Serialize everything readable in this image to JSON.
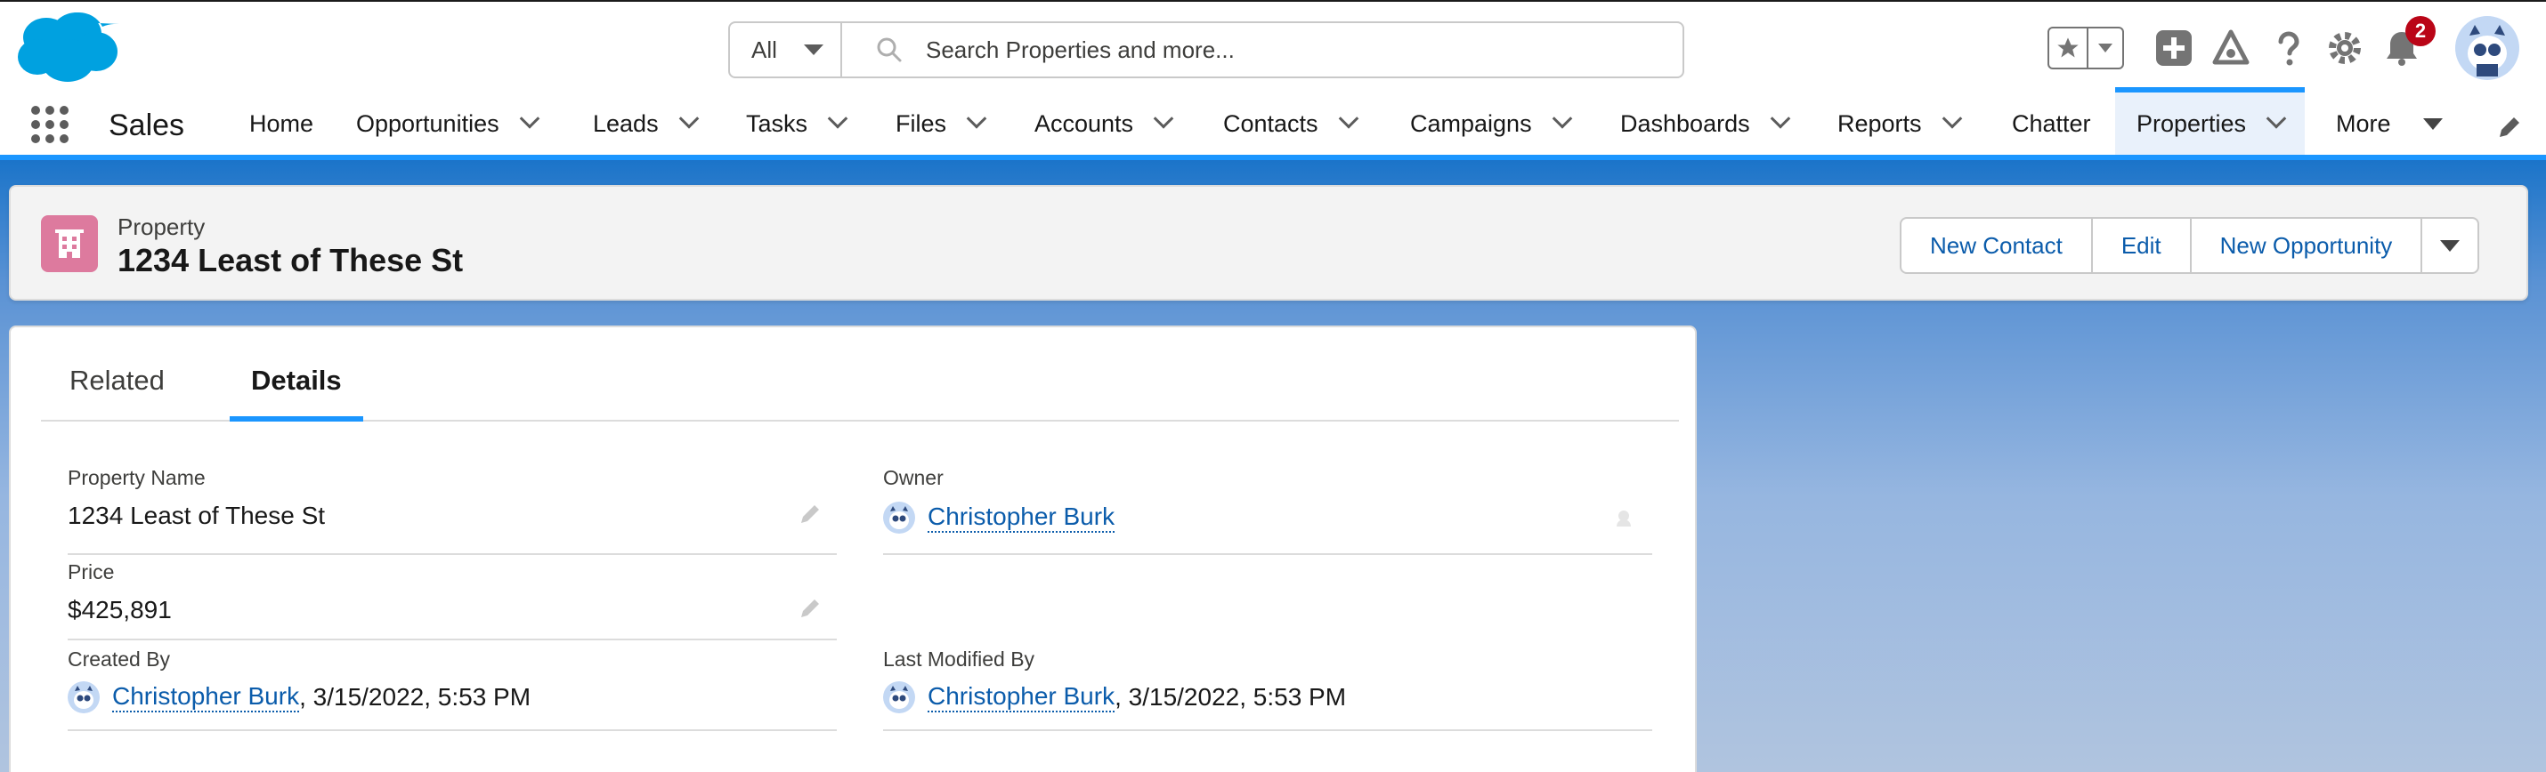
{
  "global_header": {
    "search": {
      "scope": "All",
      "placeholder": "Search Properties and more..."
    },
    "notifications_count": "2"
  },
  "navbar": {
    "app_name": "Sales",
    "items": [
      {
        "label": "Home",
        "has_menu": false
      },
      {
        "label": "Opportunities",
        "has_menu": true
      },
      {
        "label": "Leads",
        "has_menu": true
      },
      {
        "label": "Tasks",
        "has_menu": true
      },
      {
        "label": "Files",
        "has_menu": true
      },
      {
        "label": "Accounts",
        "has_menu": true
      },
      {
        "label": "Contacts",
        "has_menu": true
      },
      {
        "label": "Campaigns",
        "has_menu": true
      },
      {
        "label": "Dashboards",
        "has_menu": true
      },
      {
        "label": "Reports",
        "has_menu": true
      },
      {
        "label": "Chatter",
        "has_menu": false
      },
      {
        "label": "Properties",
        "has_menu": true,
        "active": true
      },
      {
        "label": "More",
        "has_menu": true
      }
    ]
  },
  "record": {
    "object_label": "Property",
    "title": "1234 Least of These St",
    "actions": [
      "New Contact",
      "Edit",
      "New Opportunity"
    ]
  },
  "tabs": {
    "related": "Related",
    "details": "Details",
    "active": "Details"
  },
  "fields": {
    "property_name": {
      "label": "Property Name",
      "value": "1234 Least of These St"
    },
    "owner": {
      "label": "Owner",
      "value": "Christopher Burk"
    },
    "price": {
      "label": "Price",
      "value": "$425,891"
    },
    "created_by": {
      "label": "Created By",
      "user": "Christopher Burk",
      "date": ", 3/15/2022, 5:53 PM"
    },
    "last_modified_by": {
      "label": "Last Modified By",
      "user": "Christopher Burk",
      "date": ", 3/15/2022, 5:53 PM"
    }
  },
  "colors": {
    "brand_blue": "#1b96ff",
    "link_blue": "#0b5cab",
    "property_icon": "#dd7a9e",
    "badge_red": "#ba0517"
  }
}
